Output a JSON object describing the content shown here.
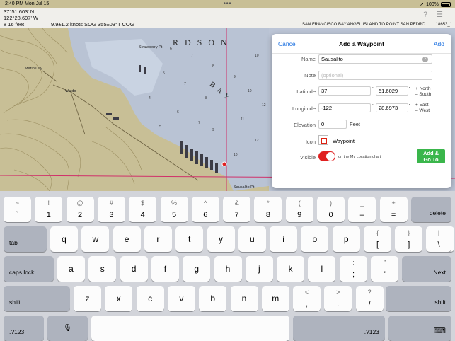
{
  "status_bar": {
    "time": "2:40 PM  Mon Jul 15",
    "battery": "100%"
  },
  "readout": {
    "latitude": "37°51.603' N",
    "longitude": "122°28.697' W",
    "depth": "± 16 feet",
    "sog": "9.9±1.2 knots SOG",
    "cog": "355±03°T COG",
    "chart_name": "SAN FRANCISCO BAY  ANGEL ISLAND TO POINT SAN PEDRO",
    "chart_number": "18653_1"
  },
  "map_labels": {
    "richardson": "R D S O N",
    "bay": "B A Y",
    "marin_city": "Marin City",
    "waldo": "Waldo",
    "strawberry": "Strawberry Pt",
    "sausalito_pt": "Sausalito Pt"
  },
  "waypoint_dialog": {
    "cancel_label": "Cancel",
    "title": "Add a Waypoint",
    "add_label": "Add",
    "name_label": "Name",
    "name_value": "Sausalito",
    "note_label": "Note",
    "note_placeholder": "(optional)",
    "latitude_label": "Latitude",
    "latitude_degrees": "37",
    "latitude_minutes": "51.6029",
    "latitude_north": "+ North",
    "latitude_south": "– South",
    "longitude_label": "Longitude",
    "longitude_degrees": "-122",
    "longitude_minutes": "28.6973",
    "longitude_east": "+ East",
    "longitude_west": "– West",
    "degree_symbol": "°",
    "minute_symbol": "'",
    "elevation_label": "Elevation",
    "elevation_value": "0",
    "elevation_unit": "Feet",
    "icon_label": "Icon",
    "icon_name": "Waypoint",
    "visible_label": "Visible",
    "visible_on": true,
    "visible_note": "on the My Location chart",
    "add_go_line1": "Add &",
    "add_go_line2": "Go To"
  },
  "keyboard": {
    "row1": [
      {
        "top": "~",
        "bot": "`"
      },
      {
        "top": "!",
        "bot": "1"
      },
      {
        "top": "@",
        "bot": "2"
      },
      {
        "top": "#",
        "bot": "3"
      },
      {
        "top": "$",
        "bot": "4"
      },
      {
        "top": "%",
        "bot": "5"
      },
      {
        "top": "^",
        "bot": "6"
      },
      {
        "top": "&",
        "bot": "7"
      },
      {
        "top": "*",
        "bot": "8"
      },
      {
        "top": "(",
        "bot": "9"
      },
      {
        "top": ")",
        "bot": "0"
      },
      {
        "top": "_",
        "bot": "–"
      },
      {
        "top": "+",
        "bot": "="
      }
    ],
    "delete": "delete",
    "tab": "tab",
    "row2": [
      "q",
      "w",
      "e",
      "r",
      "t",
      "y",
      "u",
      "i",
      "o",
      "p"
    ],
    "row2_sym": [
      {
        "top": "{",
        "bot": "["
      },
      {
        "top": "}",
        "bot": "]"
      },
      {
        "top": "|",
        "bot": "\\"
      }
    ],
    "caps_lock": "caps lock",
    "row3": [
      "a",
      "s",
      "d",
      "f",
      "g",
      "h",
      "j",
      "k",
      "l"
    ],
    "row3_sym": [
      {
        "top": ":",
        "bot": ";"
      },
      {
        "top": "\"",
        "bot": "'"
      }
    ],
    "next": "Next",
    "shift": "shift",
    "row4": [
      "z",
      "x",
      "c",
      "v",
      "b",
      "n",
      "m"
    ],
    "row4_sym": [
      {
        "top": "<",
        "bot": ","
      },
      {
        "top": ">",
        "bot": "."
      },
      {
        "top": "?",
        "bot": "/"
      }
    ],
    "numbers_left": ".?123",
    "numbers_right": ".?123",
    "mic_icon": "microphone-icon",
    "hide_keyboard_icon": "keyboard-dismiss-icon"
  }
}
